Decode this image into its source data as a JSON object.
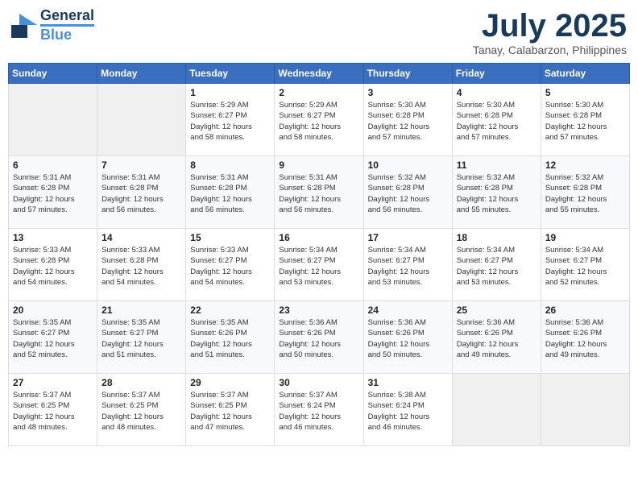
{
  "header": {
    "logo_general": "General",
    "logo_blue": "Blue",
    "month_title": "July 2025",
    "location": "Tanay, Calabarzon, Philippines"
  },
  "days_of_week": [
    "Sunday",
    "Monday",
    "Tuesday",
    "Wednesday",
    "Thursday",
    "Friday",
    "Saturday"
  ],
  "weeks": [
    [
      {
        "day": "",
        "info": ""
      },
      {
        "day": "",
        "info": ""
      },
      {
        "day": "1",
        "info": "Sunrise: 5:29 AM\nSunset: 6:27 PM\nDaylight: 12 hours\nand 58 minutes."
      },
      {
        "day": "2",
        "info": "Sunrise: 5:29 AM\nSunset: 6:27 PM\nDaylight: 12 hours\nand 58 minutes."
      },
      {
        "day": "3",
        "info": "Sunrise: 5:30 AM\nSunset: 6:28 PM\nDaylight: 12 hours\nand 57 minutes."
      },
      {
        "day": "4",
        "info": "Sunrise: 5:30 AM\nSunset: 6:28 PM\nDaylight: 12 hours\nand 57 minutes."
      },
      {
        "day": "5",
        "info": "Sunrise: 5:30 AM\nSunset: 6:28 PM\nDaylight: 12 hours\nand 57 minutes."
      }
    ],
    [
      {
        "day": "6",
        "info": "Sunrise: 5:31 AM\nSunset: 6:28 PM\nDaylight: 12 hours\nand 57 minutes."
      },
      {
        "day": "7",
        "info": "Sunrise: 5:31 AM\nSunset: 6:28 PM\nDaylight: 12 hours\nand 56 minutes."
      },
      {
        "day": "8",
        "info": "Sunrise: 5:31 AM\nSunset: 6:28 PM\nDaylight: 12 hours\nand 56 minutes."
      },
      {
        "day": "9",
        "info": "Sunrise: 5:31 AM\nSunset: 6:28 PM\nDaylight: 12 hours\nand 56 minutes."
      },
      {
        "day": "10",
        "info": "Sunrise: 5:32 AM\nSunset: 6:28 PM\nDaylight: 12 hours\nand 56 minutes."
      },
      {
        "day": "11",
        "info": "Sunrise: 5:32 AM\nSunset: 6:28 PM\nDaylight: 12 hours\nand 55 minutes."
      },
      {
        "day": "12",
        "info": "Sunrise: 5:32 AM\nSunset: 6:28 PM\nDaylight: 12 hours\nand 55 minutes."
      }
    ],
    [
      {
        "day": "13",
        "info": "Sunrise: 5:33 AM\nSunset: 6:28 PM\nDaylight: 12 hours\nand 54 minutes."
      },
      {
        "day": "14",
        "info": "Sunrise: 5:33 AM\nSunset: 6:28 PM\nDaylight: 12 hours\nand 54 minutes."
      },
      {
        "day": "15",
        "info": "Sunrise: 5:33 AM\nSunset: 6:27 PM\nDaylight: 12 hours\nand 54 minutes."
      },
      {
        "day": "16",
        "info": "Sunrise: 5:34 AM\nSunset: 6:27 PM\nDaylight: 12 hours\nand 53 minutes."
      },
      {
        "day": "17",
        "info": "Sunrise: 5:34 AM\nSunset: 6:27 PM\nDaylight: 12 hours\nand 53 minutes."
      },
      {
        "day": "18",
        "info": "Sunrise: 5:34 AM\nSunset: 6:27 PM\nDaylight: 12 hours\nand 53 minutes."
      },
      {
        "day": "19",
        "info": "Sunrise: 5:34 AM\nSunset: 6:27 PM\nDaylight: 12 hours\nand 52 minutes."
      }
    ],
    [
      {
        "day": "20",
        "info": "Sunrise: 5:35 AM\nSunset: 6:27 PM\nDaylight: 12 hours\nand 52 minutes."
      },
      {
        "day": "21",
        "info": "Sunrise: 5:35 AM\nSunset: 6:27 PM\nDaylight: 12 hours\nand 51 minutes."
      },
      {
        "day": "22",
        "info": "Sunrise: 5:35 AM\nSunset: 6:26 PM\nDaylight: 12 hours\nand 51 minutes."
      },
      {
        "day": "23",
        "info": "Sunrise: 5:36 AM\nSunset: 6:26 PM\nDaylight: 12 hours\nand 50 minutes."
      },
      {
        "day": "24",
        "info": "Sunrise: 5:36 AM\nSunset: 6:26 PM\nDaylight: 12 hours\nand 50 minutes."
      },
      {
        "day": "25",
        "info": "Sunrise: 5:36 AM\nSunset: 6:26 PM\nDaylight: 12 hours\nand 49 minutes."
      },
      {
        "day": "26",
        "info": "Sunrise: 5:36 AM\nSunset: 6:26 PM\nDaylight: 12 hours\nand 49 minutes."
      }
    ],
    [
      {
        "day": "27",
        "info": "Sunrise: 5:37 AM\nSunset: 6:25 PM\nDaylight: 12 hours\nand 48 minutes."
      },
      {
        "day": "28",
        "info": "Sunrise: 5:37 AM\nSunset: 6:25 PM\nDaylight: 12 hours\nand 48 minutes."
      },
      {
        "day": "29",
        "info": "Sunrise: 5:37 AM\nSunset: 6:25 PM\nDaylight: 12 hours\nand 47 minutes."
      },
      {
        "day": "30",
        "info": "Sunrise: 5:37 AM\nSunset: 6:24 PM\nDaylight: 12 hours\nand 46 minutes."
      },
      {
        "day": "31",
        "info": "Sunrise: 5:38 AM\nSunset: 6:24 PM\nDaylight: 12 hours\nand 46 minutes."
      },
      {
        "day": "",
        "info": ""
      },
      {
        "day": "",
        "info": ""
      }
    ]
  ]
}
